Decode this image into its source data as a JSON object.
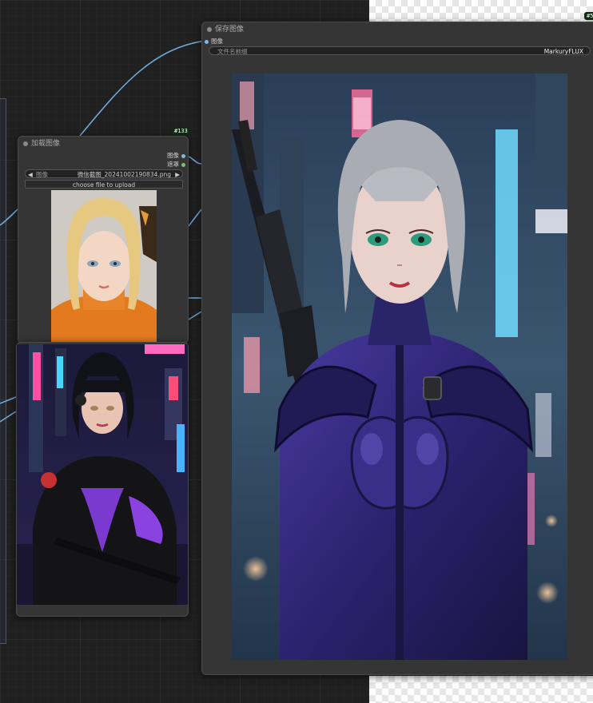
{
  "load_node": {
    "badge": "#133",
    "title": "加载图像",
    "outputs": [
      {
        "label": "图像",
        "color": "#7fb8e6"
      },
      {
        "label": "遮罩",
        "color": "#7ec27e"
      }
    ],
    "image_select": {
      "label": "图像",
      "value": "微信截图_20241002190834.png",
      "prev_icon": "◀",
      "next_icon": "▶"
    },
    "upload_button": "choose file to upload"
  },
  "save_node": {
    "badge": "#5",
    "title": "保存图像",
    "input_label": "图像",
    "prefix_field": {
      "label": "文件名前缀",
      "value": "MarkuryFLUX"
    }
  },
  "colors": {
    "canvas_bg": "#202020",
    "node_bg": "#353535",
    "wire_image": "#6fa8dc",
    "port_image": "#7fb8e6",
    "port_mask": "#7ec27e"
  }
}
